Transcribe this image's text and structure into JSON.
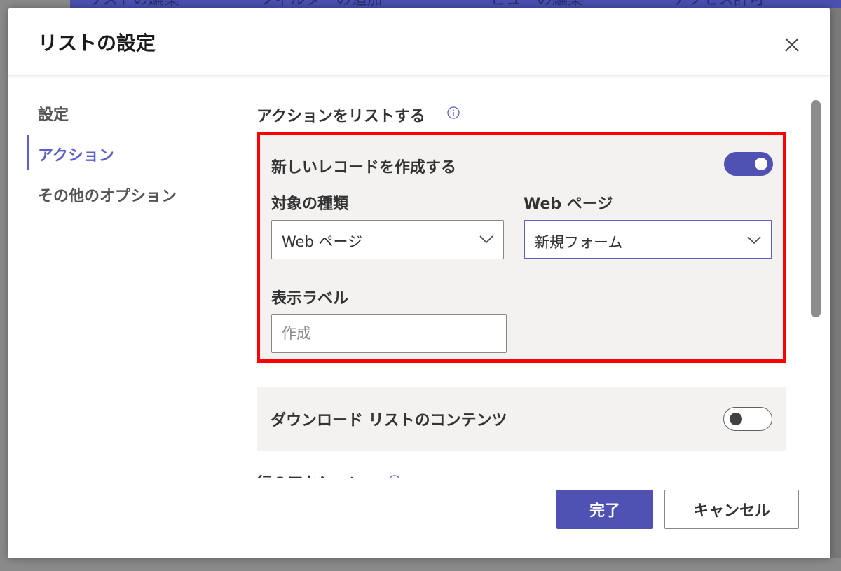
{
  "background": {
    "toolbar_items": [
      "リストの編集",
      "フィルターの追加",
      "ビューの編集",
      "アクセス許可"
    ]
  },
  "dialog": {
    "title": "リストの設定",
    "close_icon": "close-icon"
  },
  "nav": {
    "items": [
      {
        "label": "設定",
        "active": false
      },
      {
        "label": "アクション",
        "active": true
      },
      {
        "label": "その他のオプション",
        "active": false
      }
    ]
  },
  "content": {
    "section_title": "アクションをリストする",
    "create_record": {
      "title": "新しいレコードを作成する",
      "enabled": true,
      "target_type_label": "対象の種類",
      "target_type_value": "Web ページ",
      "web_page_label": "Web ページ",
      "web_page_value": "新規フォーム",
      "display_label_label": "表示ラベル",
      "display_label_placeholder": "作成"
    },
    "download_list": {
      "title": "ダウンロード リストのコンテンツ",
      "enabled": false
    },
    "row_actions_title": "行のアクション"
  },
  "footer": {
    "done_label": "完了",
    "cancel_label": "キャンセル"
  },
  "colors": {
    "accent": "#5b5fc7",
    "highlight": "#ff0000"
  }
}
